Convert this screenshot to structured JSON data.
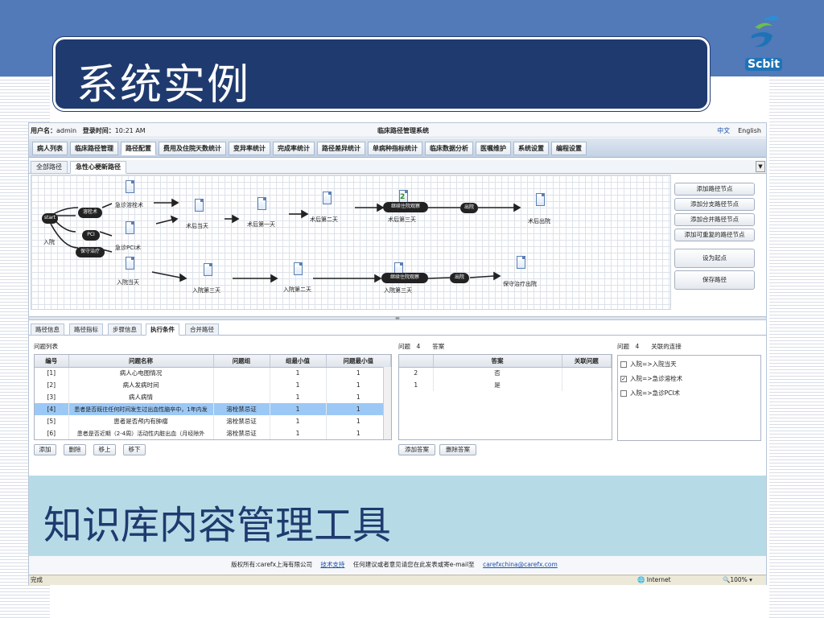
{
  "slide": {
    "title": "系统实例",
    "footer_caption": "知识库内容管理工具",
    "logo_text": "Scbit",
    "accent": "#5279b8",
    "title_bg": "#1f3a6e"
  },
  "app": {
    "user_label": "用户名：",
    "user": "admin",
    "login_label": "登录时间：",
    "login_time": "10:21 AM",
    "system_title": "临床路径管理系统",
    "lang_zh": "中文",
    "lang_en": "English",
    "nav": [
      "病人列表",
      "临床路径管理",
      "路径配置",
      "费用及住院天数统计",
      "变异率统计",
      "完成率统计",
      "路径差异统计",
      "单病种指标统计",
      "临床数据分析",
      "医嘱维护",
      "系统设置",
      "编程设置"
    ],
    "nav_active": 2,
    "subtabs": [
      "全部路径",
      "急性心梗新路径"
    ],
    "canvas": {
      "pills": [
        "溶栓术",
        "PCI",
        "保守治疗",
        "继续住院观察",
        "出院",
        "继续住院观察",
        "出院"
      ],
      "labels": [
        "start",
        "入院",
        "急诊溶栓术",
        "急诊PCI术",
        "入院当天",
        "术后当天",
        "术后第一天",
        "术后第二天",
        "术后第三天",
        "术后出院",
        "入院第三天",
        "入院第二天",
        "入院第三天",
        "保守治疗出院",
        "2"
      ]
    },
    "actions": [
      "添加路径节点",
      "添加分支路径节点",
      "添加合并路径节点",
      "添加可重复的路径节点",
      "设为起点",
      "保存路径"
    ],
    "lower_tabs": [
      "路径信息",
      "路径指标",
      "步骤信息",
      "执行条件",
      "合并路径"
    ],
    "lower_active": 3,
    "q_title": "问题列表",
    "q_headers": [
      "编号",
      "问题名称",
      "问题组",
      "组最小值",
      "问题最小值"
    ],
    "q_rows": [
      [
        "[1]",
        "病人心电图情况",
        "",
        "1",
        "1"
      ],
      [
        "[2]",
        "病人发病时间",
        "",
        "1",
        "1"
      ],
      [
        "[3]",
        "病人病情",
        "",
        "1",
        "1"
      ],
      [
        "[4]",
        "患者是否既往任何时间发生过出血性脑卒中，1年内发",
        "溶栓禁忌证",
        "1",
        "1"
      ],
      [
        "[5]",
        "患者是否颅内有肿瘤",
        "溶栓禁忌证",
        "1",
        "1"
      ],
      [
        "[6]",
        "患者是否近期（2-4周）活动性内脏出血（月经除外",
        "溶栓禁忌证",
        "1",
        "1"
      ]
    ],
    "q_selected": 3,
    "q_buttons": [
      "添加",
      "删除",
      "移上",
      "移下"
    ],
    "a_title": "问题　4　　答案",
    "a_headers": [
      "",
      "答案",
      "关联问题"
    ],
    "a_rows": [
      [
        "2",
        "否",
        ""
      ],
      [
        "1",
        "是",
        ""
      ]
    ],
    "a_buttons": [
      "添加答案",
      "删除答案"
    ],
    "link_title": "问题　4　　关联的连接",
    "links": [
      {
        "label": "入院=>入院当天",
        "checked": false
      },
      {
        "label": "入院=>急诊溶栓术",
        "checked": true
      },
      {
        "label": "入院=>急诊PCI术",
        "checked": false
      }
    ],
    "copyright": "版权所有:carefx上海有限公司",
    "support": "技术支持",
    "feedback": "任何建议或者意见请您在此发表或寄e-mail至",
    "email": "carefxchina@carefx.com",
    "status_done": "完成",
    "status_zone": "Internet",
    "status_zoom": "100%"
  }
}
